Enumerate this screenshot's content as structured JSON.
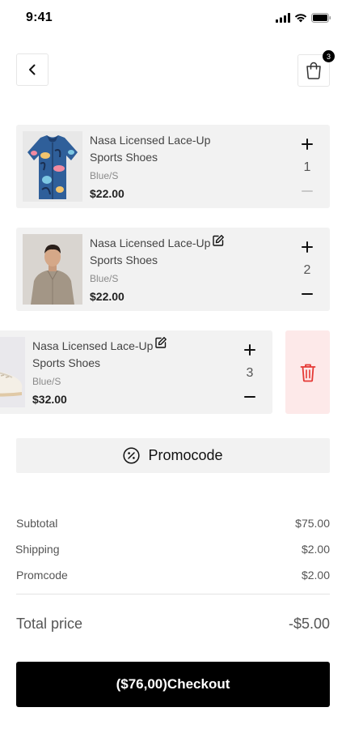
{
  "status_bar": {
    "time": "9:41"
  },
  "header": {
    "cart_count": "3"
  },
  "items": [
    {
      "title": "Nasa Licensed Lace-Up Sports Shoes",
      "variant": "Blue/S",
      "price": "$22.00",
      "quantity": "1",
      "image": "floral-shirt"
    },
    {
      "title": "Nasa Licensed Lace-Up Sports Shoes",
      "variant": "Blue/S",
      "price": "$22.00",
      "quantity": "2",
      "image": "man-in-shirt"
    },
    {
      "title": "Nasa Licensed Lace-Up Sports Shoes",
      "variant": "Blue/S",
      "price": "$32.00",
      "quantity": "3",
      "image": "white-sneaker"
    }
  ],
  "promo": {
    "label": "Promocode"
  },
  "summary": {
    "subtotal_label": "Subtotal",
    "subtotal_value": "$75.00",
    "shipping_label": "Shipping",
    "shipping_value": "$2.00",
    "promocode_label": "Promcode",
    "promocode_value": "$2.00",
    "total_label": "Total price",
    "total_value": "-$5.00"
  },
  "checkout": {
    "label": "($76,00)Checkout"
  },
  "colors": {
    "accent": "#000000",
    "delete_bg": "#fde9e9",
    "delete_icon": "#e53935",
    "card_bg": "#f2f2f2"
  }
}
